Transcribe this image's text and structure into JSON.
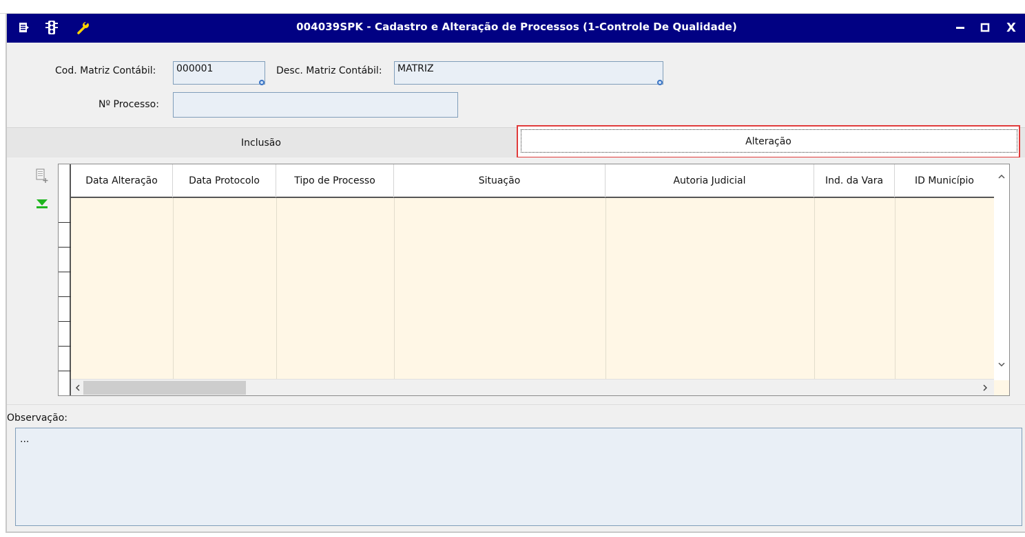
{
  "window": {
    "title": "004039SPK - Cadastro e Alteração de Processos (1-Controle De Qualidade)",
    "controls": {
      "minimize": "▬",
      "maximize": "□",
      "close": "X"
    }
  },
  "form": {
    "cod_matriz_label": "Cod. Matriz Contábil:",
    "cod_matriz_value": "000001",
    "desc_matriz_label": "Desc. Matriz Contábil:",
    "desc_matriz_value": "MATRIZ",
    "processo_label": "Nº Processo:",
    "processo_value": ""
  },
  "tabs": [
    {
      "label": "Inclusão",
      "active": false
    },
    {
      "label": "Alteração",
      "active": true
    }
  ],
  "grid": {
    "columns": [
      "Data Alteração",
      "Data Protocolo",
      "Tipo de Processo",
      "Situação",
      "Autoria Judicial",
      "Ind. da Vara",
      "ID Município"
    ],
    "rows": []
  },
  "observacao": {
    "label": "Observação:",
    "value": "..."
  },
  "icons": {
    "title_left": [
      "menu-icon",
      "traffic-light-icon",
      "wrench-icon"
    ],
    "side": [
      "add-record-icon",
      "download-arrow-icon"
    ]
  },
  "colors": {
    "titlebar": "#010183",
    "grid_body": "#fff7e6",
    "field_bg": "#e9eff6",
    "active_tab_border": "#e03a3a"
  }
}
